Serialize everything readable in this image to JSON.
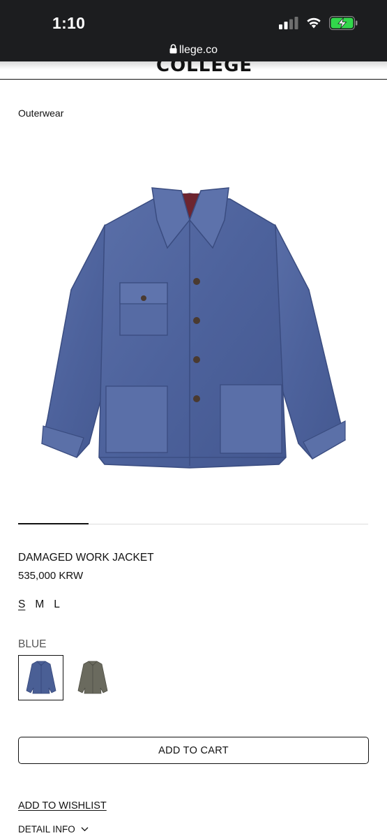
{
  "status_bar": {
    "time": "1:10",
    "signal_icon": "cellular-signal-icon",
    "wifi_icon": "wifi-icon",
    "battery_icon": "battery-charging-icon",
    "battery_color": "#32d74b"
  },
  "browser": {
    "url": "llege.co",
    "lock_icon": "lock-icon"
  },
  "header": {
    "logo_text": "COLLEGE"
  },
  "category": "Outerwear",
  "product": {
    "image_icon": "denim-jacket-image",
    "name": "DAMAGED WORK JACKET",
    "price": "535,000 KRW",
    "sizes": [
      "S",
      "M",
      "L"
    ],
    "selected_size": "S",
    "color_name": "BLUE",
    "swatches": [
      {
        "name": "blue-jacket-swatch",
        "color": "#4a5f95",
        "selected": true
      },
      {
        "name": "gray-jacket-swatch",
        "color": "#6a6a5e",
        "selected": false
      }
    ]
  },
  "gallery": {
    "current_slide": 1,
    "total_slides": 5
  },
  "actions": {
    "add_to_cart": "ADD TO CART",
    "add_to_wishlist": "ADD TO WISHLIST",
    "detail_info": "DETAIL INFO",
    "detail_icon": "chevron-down-icon"
  }
}
